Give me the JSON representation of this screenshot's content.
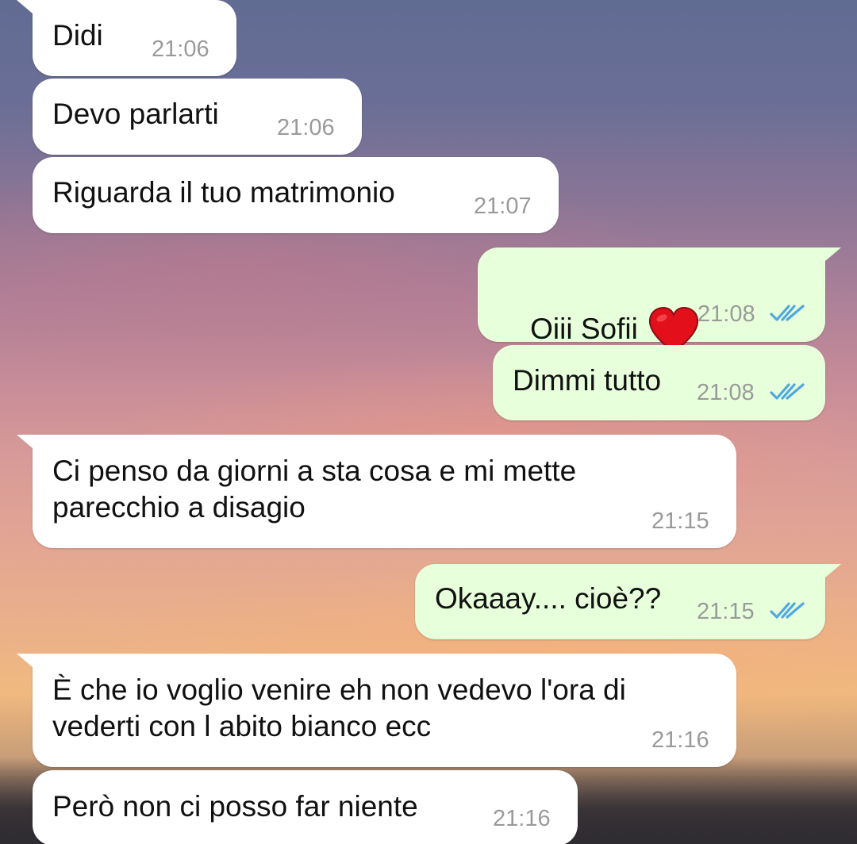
{
  "colors": {
    "incoming_bubble": "#ffffff",
    "outgoing_bubble": "#e7ffdb",
    "timestamp": "#9a9a9a",
    "read_ticks": "#4fa8e0"
  },
  "messages": [
    {
      "direction": "incoming",
      "text": "Didi",
      "time": "21:06"
    },
    {
      "direction": "incoming",
      "text": "Devo parlarti",
      "time": "21:06"
    },
    {
      "direction": "incoming",
      "text": "Riguarda il tuo matrimonio",
      "time": "21:07"
    },
    {
      "direction": "outgoing",
      "text": "Oiii Sofii",
      "emoji": "red-heart",
      "time": "21:08",
      "status": "read"
    },
    {
      "direction": "outgoing",
      "text": "Dimmi tutto",
      "time": "21:08",
      "status": "read"
    },
    {
      "direction": "incoming",
      "text": "Ci penso da giorni a sta cosa e mi mette\nparecchio a disagio",
      "time": "21:15"
    },
    {
      "direction": "outgoing",
      "text": "Okaaay.... cioè??",
      "time": "21:15",
      "status": "read"
    },
    {
      "direction": "incoming",
      "text": "È che io voglio venire eh non vedevo l'ora di\nvederti con l abito bianco ecc",
      "time": "21:16"
    },
    {
      "direction": "incoming",
      "text": "Però non ci posso far niente",
      "time": "21:16"
    }
  ]
}
